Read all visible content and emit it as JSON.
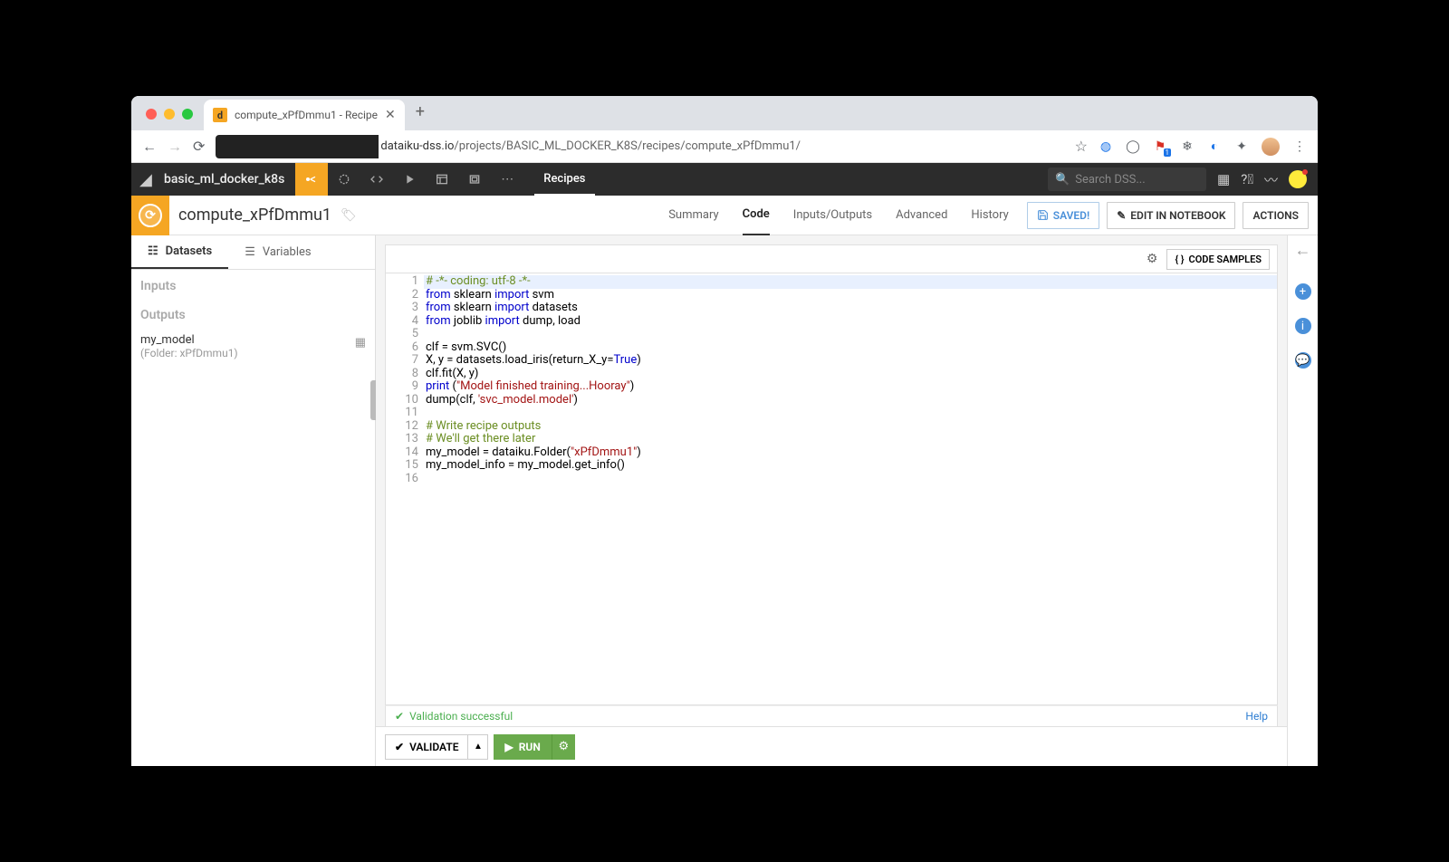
{
  "browser": {
    "tab_title": "compute_xPfDmmu1 - Recipe",
    "url_host": "dataiku-dss.io",
    "url_path": "/projects/BASIC_ML_DOCKER_K8S/recipes/compute_xPfDmmu1/"
  },
  "app": {
    "project_name": "basic_ml_docker_k8s",
    "section_label": "Recipes",
    "search_placeholder": "Search DSS..."
  },
  "recipe": {
    "title": "compute_xPfDmmu1",
    "tabs": [
      "Summary",
      "Code",
      "Inputs/Outputs",
      "Advanced",
      "History"
    ],
    "active_tab": "Code",
    "saved_label": "SAVED!",
    "edit_label": "EDIT IN NOTEBOOK",
    "actions_label": "ACTIONS"
  },
  "left": {
    "tabs": {
      "datasets": "Datasets",
      "variables": "Variables"
    },
    "inputs_label": "Inputs",
    "outputs_label": "Outputs",
    "outputs": [
      {
        "name": "my_model",
        "folder": "(Folder: xPfDmmu1)"
      }
    ]
  },
  "editor": {
    "code_samples_label": "CODE SAMPLES",
    "validation_text": "Validation successful",
    "help_label": "Help",
    "validate_label": "VALIDATE",
    "run_label": "RUN",
    "lines": [
      {
        "tokens": [
          {
            "t": "# -*- coding: utf-8 -*-",
            "c": "c-comment"
          }
        ],
        "hl": true
      },
      {
        "tokens": [
          {
            "t": "from",
            "c": "c-kw"
          },
          {
            "t": " sklearn "
          },
          {
            "t": "import",
            "c": "c-kw"
          },
          {
            "t": " svm"
          }
        ]
      },
      {
        "tokens": [
          {
            "t": "from",
            "c": "c-kw"
          },
          {
            "t": " sklearn "
          },
          {
            "t": "import",
            "c": "c-kw"
          },
          {
            "t": " datasets"
          }
        ]
      },
      {
        "tokens": [
          {
            "t": "from",
            "c": "c-kw"
          },
          {
            "t": " joblib "
          },
          {
            "t": "import",
            "c": "c-kw"
          },
          {
            "t": " dump, load"
          }
        ]
      },
      {
        "tokens": []
      },
      {
        "tokens": [
          {
            "t": "clf = svm.SVC()"
          }
        ]
      },
      {
        "tokens": [
          {
            "t": "X, y = datasets.load_iris(return_X_y="
          },
          {
            "t": "True",
            "c": "c-kw"
          },
          {
            "t": ")"
          }
        ]
      },
      {
        "tokens": [
          {
            "t": "clf.fit(X, y)"
          }
        ]
      },
      {
        "tokens": [
          {
            "t": "print",
            "c": "c-builtin"
          },
          {
            "t": " ("
          },
          {
            "t": "\"Model finished training...Hooray\"",
            "c": "c-str"
          },
          {
            "t": ")"
          }
        ]
      },
      {
        "tokens": [
          {
            "t": "dump(clf, "
          },
          {
            "t": "'svc_model.model'",
            "c": "c-str"
          },
          {
            "t": ")"
          }
        ]
      },
      {
        "tokens": []
      },
      {
        "tokens": [
          {
            "t": "# Write recipe outputs",
            "c": "c-comment"
          }
        ]
      },
      {
        "tokens": [
          {
            "t": "# We'll get there later",
            "c": "c-comment"
          }
        ]
      },
      {
        "tokens": [
          {
            "t": "my_model = dataiku.Folder("
          },
          {
            "t": "\"xPfDmmu1\"",
            "c": "c-str"
          },
          {
            "t": ")"
          }
        ]
      },
      {
        "tokens": [
          {
            "t": "my_model_info = my_model.get_info()"
          }
        ]
      },
      {
        "tokens": []
      }
    ]
  }
}
